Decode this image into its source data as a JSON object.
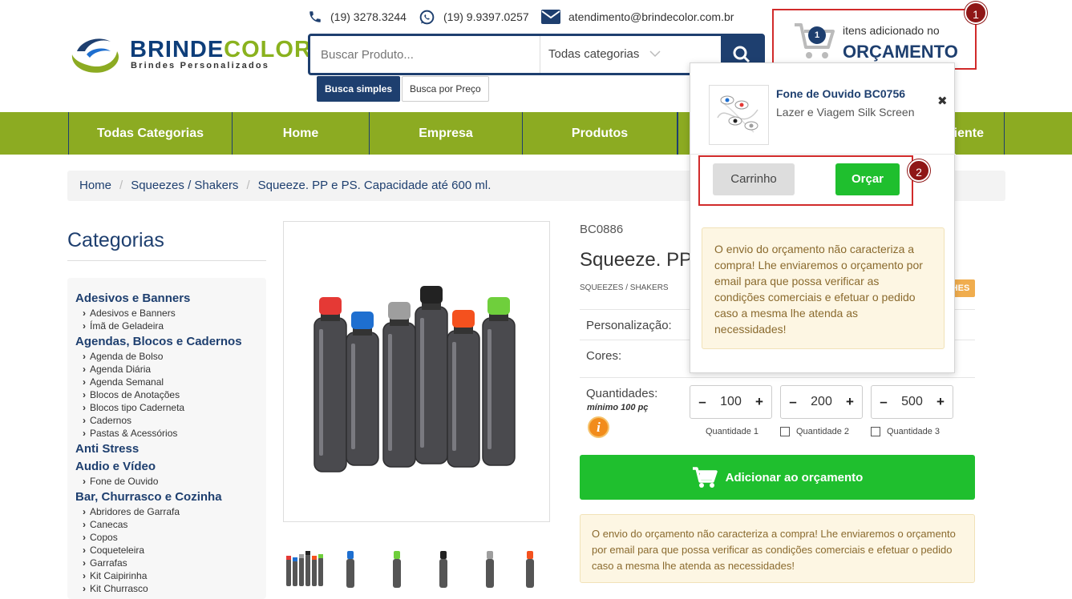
{
  "header": {
    "brand_part1": "BRINDE",
    "brand_part2": "COLOR",
    "tagline": "Brindes Personalizados",
    "phone": "(19) 3278.3244",
    "whatsapp": "(19) 9.9397.0257",
    "email": "atendimento@brindecolor.com.br"
  },
  "search": {
    "placeholder": "Buscar Produto...",
    "category": "Todas categorias",
    "tab_simple": "Busca simples",
    "tab_price": "Busca por Preço"
  },
  "cart": {
    "count": "1",
    "line1": "itens adicionado no",
    "line2": "ORÇAMENTO"
  },
  "annotations": {
    "mark1": "1",
    "mark2": "2"
  },
  "nav": [
    "Todas Categorias",
    "Home",
    "Empresa",
    "Produtos",
    "iente"
  ],
  "breadcrumb": {
    "home": "Home",
    "sep": "/",
    "category": "Squeezes / Shakers",
    "current": "Squeeze. PP e PS. Capacidade até 600 ml."
  },
  "sidebar": {
    "title": "Categorias",
    "groups": [
      {
        "name": "Adesivos e Banners",
        "items": [
          "Adesivos e Banners",
          "Ímã de Geladeira"
        ]
      },
      {
        "name": "Agendas, Blocos e Cadernos",
        "items": [
          "Agenda de Bolso",
          "Agenda Diária",
          "Agenda Semanal",
          "Blocos de Anotações",
          "Blocos tipo Caderneta",
          "Cadernos",
          "Pastas & Acessórios"
        ]
      },
      {
        "name": "Anti Stress",
        "items": []
      },
      {
        "name": "Audio e Vídeo",
        "items": [
          "Fone de Ouvido"
        ]
      },
      {
        "name": "Bar, Churrasco e Cozinha",
        "items": [
          "Abridores de Garrafa",
          "Canecas",
          "Copos",
          "Coqueteleira",
          "Garrafas",
          "Kit Caipirinha",
          "Kit Churrasco"
        ]
      }
    ]
  },
  "product": {
    "code": "BC0886",
    "title": "Squeeze. PP e",
    "category": "SQUEEZES / SHAKERS",
    "badge": "HES",
    "personalization_label": "Personalização:",
    "colors_label": "Cores:",
    "quantities_label": "Quantidades:",
    "min_label": "mínimo 100 pç",
    "info_icon": "i",
    "quantities": [
      {
        "value": "100",
        "label": "Quantidade 1"
      },
      {
        "value": "200",
        "label": "Quantidade 2"
      },
      {
        "value": "500",
        "label": "Quantidade 3"
      }
    ],
    "minus": "–",
    "plus": "+",
    "add_button": "Adicionar ao orçamento",
    "notice": "O envio do orçamento não caracteriza a compra! Lhe enviaremos o orçamento por email para que possa verificar as condições comerciais e efetuar o pedido caso a mesma lhe atenda as necessidades!"
  },
  "dropdown": {
    "item_name": "Fone de Ouvido BC0756",
    "item_sub": "Lazer e Viagem Silk Screen",
    "remove": "✖",
    "cart_button": "Carrinho",
    "quote_button": "Orçar",
    "notice": "O envio do orçamento não caracteriza a compra! Lhe enviaremos o orçamento por email para que possa verificar as condições comerciais e efetuar o pedido caso a mesma lhe atenda as necessidades!"
  },
  "colors": {
    "navy": "#1e3f6f",
    "green_nav": "#8cab22",
    "button_green": "#1fbf2e",
    "highlight_red": "#d12b2b",
    "bottle_caps": [
      "#e53935",
      "#1e6fd0",
      "#9e9e9e",
      "#222222",
      "#f4511e",
      "#6fcf3c"
    ]
  }
}
